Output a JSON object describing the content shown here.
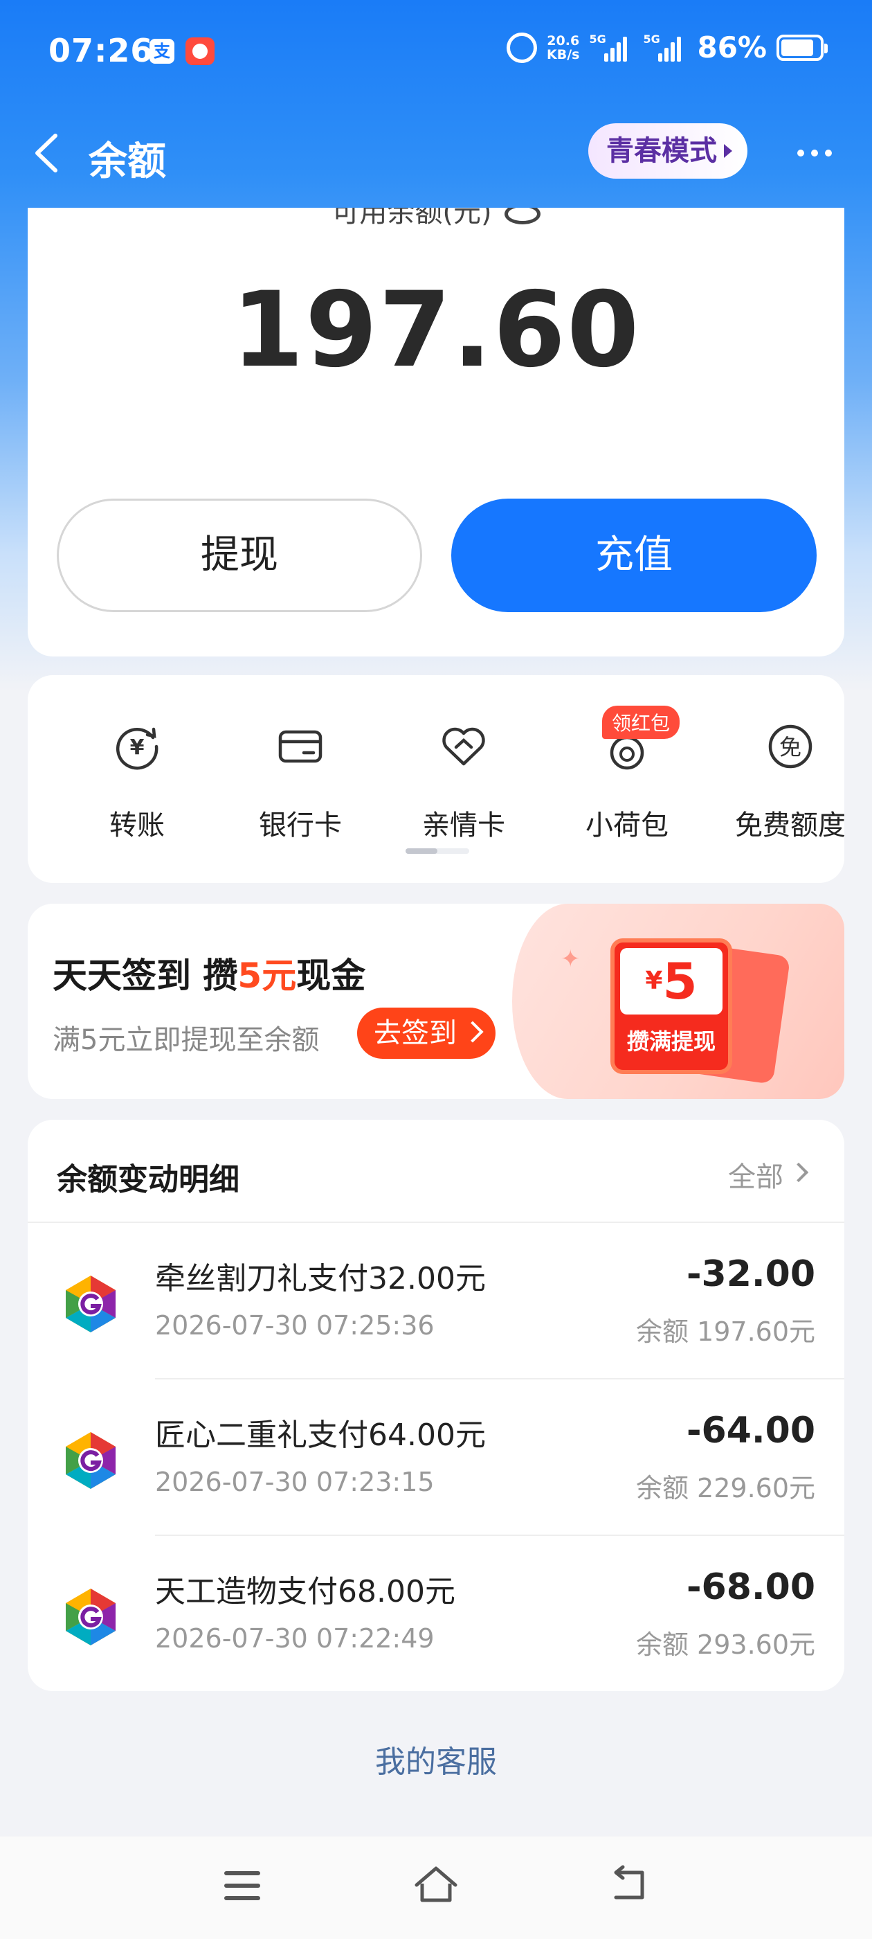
{
  "status_bar": {
    "time": "07:26",
    "net_speed_value": "20.6",
    "net_speed_unit": "KB/s",
    "signal_1_label": "5G",
    "signal_2_label": "5G",
    "battery": "86%",
    "app_icon_1_char": "支"
  },
  "nav": {
    "title": "余额",
    "youth_mode": "青春模式"
  },
  "balance": {
    "label": "可用余额(元)",
    "amount": "197.60",
    "withdraw_label": "提现",
    "recharge_label": "充值"
  },
  "quick_actions": {
    "items": [
      {
        "label": "转账",
        "icon": "transfer-icon"
      },
      {
        "label": "银行卡",
        "icon": "bank-card-icon"
      },
      {
        "label": "亲情卡",
        "icon": "family-card-icon"
      },
      {
        "label": "小荷包",
        "icon": "pouch-icon"
      },
      {
        "label": "免费额度",
        "icon": "free-quota-icon"
      }
    ],
    "badge": "领红包"
  },
  "promo": {
    "title_prefix": "天天签到 攒",
    "title_highlight": "5元",
    "title_suffix": "现金",
    "subtitle": "满5元立即提现至余额",
    "button": "去签到",
    "coupon_currency": "¥",
    "coupon_value": "5",
    "coupon_text": "攒满提现"
  },
  "details": {
    "title": "余额变动明细",
    "all_label": "全部",
    "transactions": [
      {
        "title": "牵丝割刀礼支付32.00元",
        "time": "2026-07-30 07:25:36",
        "amount": "-32.00",
        "balance": "余额 197.60元"
      },
      {
        "title": "匠心二重礼支付64.00元",
        "time": "2026-07-30 07:23:15",
        "amount": "-64.00",
        "balance": "余额 229.60元"
      },
      {
        "title": "天工造物支付68.00元",
        "time": "2026-07-30 07:22:49",
        "amount": "-68.00",
        "balance": "余额 293.60元"
      }
    ]
  },
  "footer": {
    "service_label": "我的客服"
  },
  "colors": {
    "primary": "#1677ff",
    "promo_red": "#ff4418",
    "header_blue": "#1a7cf7"
  }
}
